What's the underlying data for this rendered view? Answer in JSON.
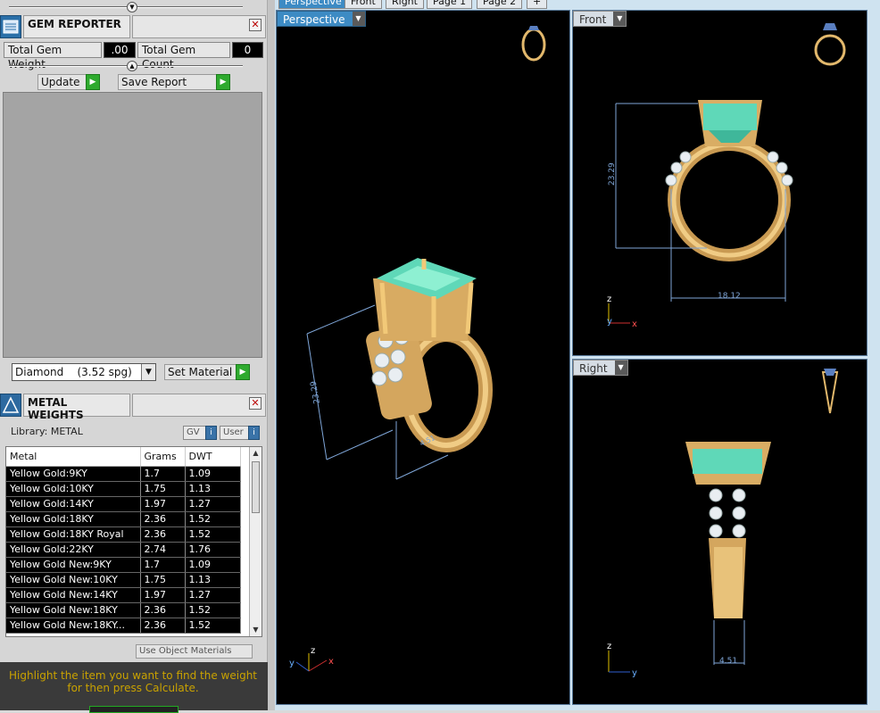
{
  "gem_reporter": {
    "title": "GEM REPORTER",
    "close": "✕",
    "total_weight_label": "Total Gem Weight",
    "total_weight_value": ".00",
    "total_count_label": "Total Gem Count",
    "total_count_value": "0",
    "update_label": "Update",
    "save_report_label": "Save Report",
    "material_select": "Diamond    (3.52 spg)",
    "set_material_label": "Set Material"
  },
  "metal_weights": {
    "title": "METAL WEIGHTS",
    "close": "✕",
    "library_label": "Library: METAL",
    "gv_label": "GV",
    "user_label": "User",
    "columns": [
      "Metal",
      "Grams",
      "DWT"
    ],
    "rows": [
      [
        "Yellow Gold:9KY",
        "1.7",
        "1.09"
      ],
      [
        "Yellow Gold:10KY",
        "1.75",
        "1.13"
      ],
      [
        "Yellow Gold:14KY",
        "1.97",
        "1.27"
      ],
      [
        "Yellow Gold:18KY",
        "2.36",
        "1.52"
      ],
      [
        "Yellow Gold:18KY Royal",
        "2.36",
        "1.52"
      ],
      [
        "Yellow Gold:22KY",
        "2.74",
        "1.76"
      ],
      [
        "Yellow Gold New:9KY",
        "1.7",
        "1.09"
      ],
      [
        "Yellow Gold New:10KY",
        "1.75",
        "1.13"
      ],
      [
        "Yellow Gold New:14KY",
        "1.97",
        "1.27"
      ],
      [
        "Yellow Gold New:18KY",
        "2.36",
        "1.52"
      ],
      [
        "Yellow Gold New:18KY...",
        "2.36",
        "1.52"
      ]
    ],
    "use_object_materials": "Use Object Materials",
    "hint": "Highlight the item you want to find the weight for then press Calculate."
  },
  "tabs": [
    "Perspective",
    "Front",
    "Right",
    "Page 1",
    "Page 2",
    "+"
  ],
  "viewports": {
    "perspective": {
      "label": "Perspective",
      "dimension": "23.29",
      "dimension2": "4.51",
      "axes": [
        "y",
        "z",
        "x"
      ]
    },
    "front": {
      "label": "Front",
      "dimension_v": "23.29",
      "dimension_h": "18.12",
      "axes": [
        "z",
        "y",
        "x"
      ]
    },
    "right": {
      "label": "Right",
      "dimension_h": "4.51",
      "axes": [
        "z",
        "y"
      ]
    }
  },
  "colors": {
    "gold": "#e2b86c",
    "emerald": "#5fd8b8",
    "dimension": "#7fa6d8"
  }
}
